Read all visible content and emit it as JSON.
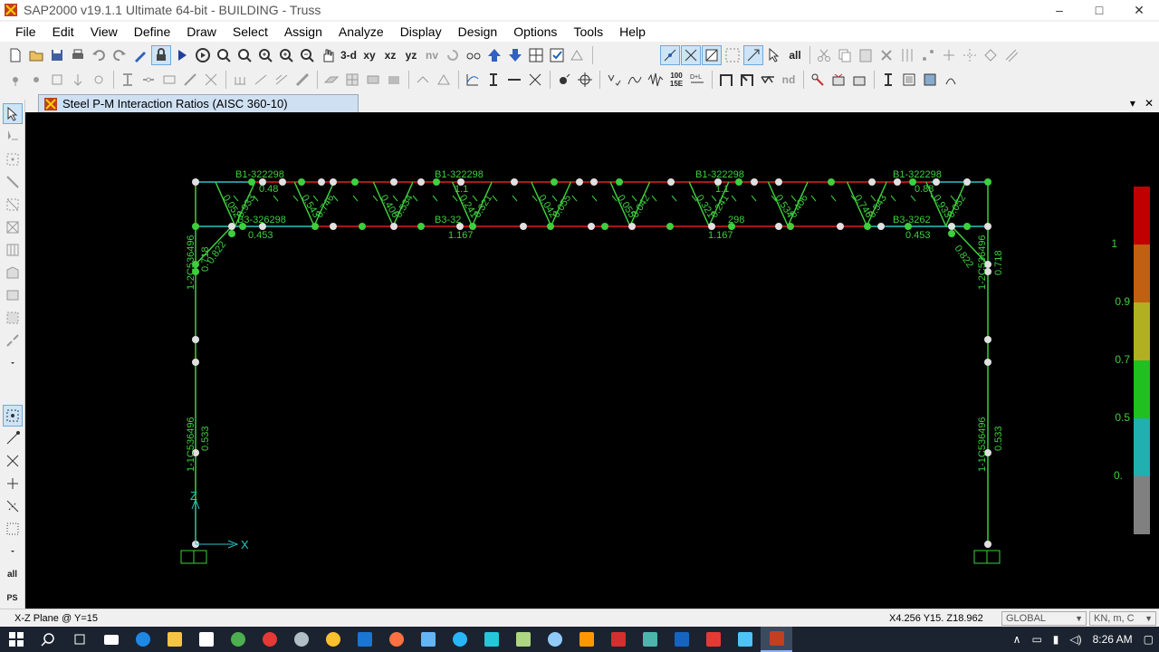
{
  "window": {
    "title": "SAP2000 v19.1.1 Ultimate 64-bit - BUILDING - Truss",
    "minimize": "–",
    "maximize": "□",
    "close": "✕"
  },
  "menu": [
    "File",
    "Edit",
    "View",
    "Define",
    "Draw",
    "Select",
    "Assign",
    "Analyze",
    "Display",
    "Design",
    "Options",
    "Tools",
    "Help"
  ],
  "toolbar": {
    "view_3d": "3-d",
    "view_xy": "xy",
    "view_xz": "xz",
    "view_yz": "yz",
    "view_nv": "nv",
    "all_label": "all",
    "nd_label": "nd",
    "val_1": "100",
    "val_2": "15E",
    "ps_label": "PS"
  },
  "document_tab": {
    "label": "Steel P-M Interaction Ratios  (AISC 360-10)",
    "dropdown": "▾",
    "close": "✕"
  },
  "diagram": {
    "axis_z": "Z",
    "axis_x": "X",
    "top_labels": [
      "B1-322298",
      "B1-322298",
      "B1-322298",
      "B1-322298"
    ],
    "top_ratios": [
      "0.48",
      "1.1",
      "1.1",
      "0.88"
    ],
    "bottom_chord_labels": [
      "B3-326298",
      "B3-32",
      "298",
      "B3-3262"
    ],
    "bottom_ratios": [
      "0.453",
      "1.167",
      "1.167",
      "0.453"
    ],
    "diag_ratios": [
      "0.052",
      "0.933",
      "0.543",
      "0.746",
      "0.406",
      "0.534",
      "0.241",
      "0.321",
      "0.042",
      "0.055",
      "0.055",
      "0.042",
      "0.321",
      "0.241",
      "0.534",
      "0.406",
      "0.746",
      "0.543",
      "0.933",
      "0.052"
    ],
    "knee_ratios": [
      "0.822",
      "0.822"
    ],
    "column_upper_left_label": "1-2C536496",
    "column_upper_left_ratio": "0.718",
    "column_upper_right_label": "1-2C536496",
    "column_upper_right_ratio": "0.718",
    "column_lower_left_label": "1-1C536496",
    "column_lower_left_ratio": "0.533",
    "column_lower_right_label": "1-1C536496",
    "column_lower_right_ratio": "0.533",
    "legend_ticks": [
      "1",
      "0.9",
      "0.7",
      "0.5",
      "0."
    ],
    "legend_colors": [
      "#c00000",
      "#c06010",
      "#b0b020",
      "#20c020",
      "#20b0b0",
      "#808080"
    ]
  },
  "status": {
    "plane": "X-Z Plane @ Y=15",
    "coords": "X4.256  Y15.  Z18.962",
    "coord_system": "GLOBAL",
    "units": "KN, m, C"
  },
  "taskbar": {
    "time": "8:26 AM",
    "tray_up": "∧"
  }
}
